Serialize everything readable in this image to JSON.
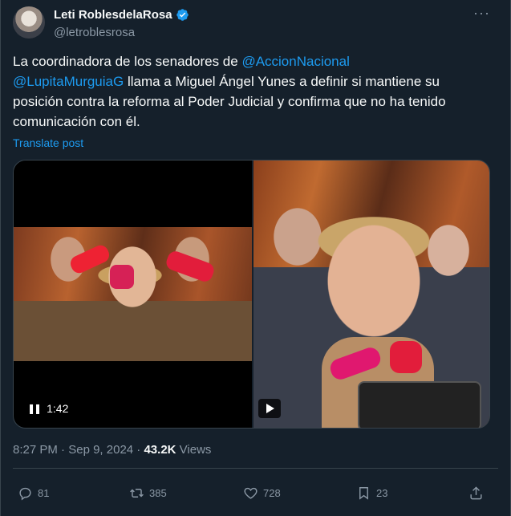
{
  "author": {
    "display_name": "Leti RoblesdelaRosa",
    "handle": "@letroblesrosa",
    "verified": true
  },
  "tweet": {
    "text_part1": "La coordinadora de los senadores de ",
    "mention1": "@AccionNacional",
    "text_part2": " ",
    "mention2": "@LupitaMurguiaG",
    "text_part3": " llama a Miguel Ángel Yunes a definir si mantiene su posición contra la reforma al Poder Judicial y confirma que no ha tenido comunicación con él.",
    "translate_label": "Translate post"
  },
  "media": {
    "video_duration": "1:42"
  },
  "meta": {
    "time": "8:27 PM",
    "separator": " · ",
    "date": "Sep 9, 2024",
    "views_count": "43.2K",
    "views_label": " Views"
  },
  "actions": {
    "replies": "81",
    "reposts": "385",
    "likes": "728",
    "bookmarks": "23"
  },
  "colors": {
    "background": "#15202b",
    "accent": "#1d9bf0",
    "muted_text": "#8b98a5",
    "border": "#38444d"
  },
  "icons": [
    "verified-badge-icon",
    "more-options-icon",
    "pause-icon",
    "play-icon",
    "reply-icon",
    "repost-icon",
    "like-icon",
    "bookmark-icon",
    "share-icon"
  ]
}
